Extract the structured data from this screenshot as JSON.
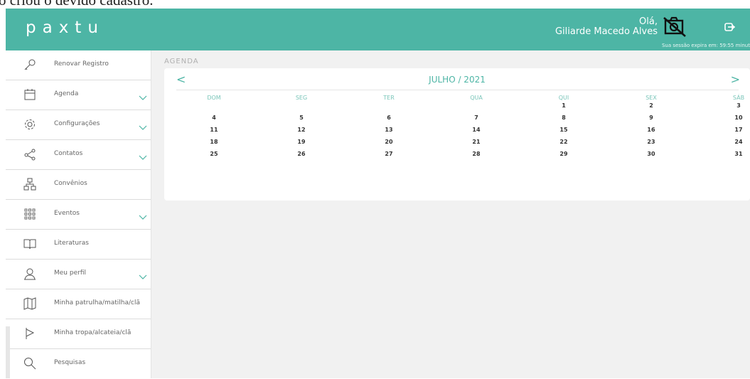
{
  "top_text": "o criou o devido cadastro.",
  "header": {
    "logo": "paxtu",
    "greeting": "Olá,",
    "user_name": "Giliarde Macedo Alves",
    "session_text": "Sua sessão expira em: 59:55 minut",
    "camera_icon": "camera-off-icon",
    "logout_icon": "logout-icon"
  },
  "sidebar": {
    "items": [
      {
        "label": "Renovar Registro",
        "icon": "key-icon",
        "has_submenu": false
      },
      {
        "label": "Agenda",
        "icon": "calendar-icon",
        "has_submenu": true
      },
      {
        "label": "Configurações",
        "icon": "gear-icon",
        "has_submenu": true
      },
      {
        "label": "Contatos",
        "icon": "share-icon",
        "has_submenu": true
      },
      {
        "label": "Convênios",
        "icon": "network-icon",
        "has_submenu": false
      },
      {
        "label": "Eventos",
        "icon": "grid-icon",
        "has_submenu": true
      },
      {
        "label": "Literaturas",
        "icon": "book-icon",
        "has_submenu": false
      },
      {
        "label": "Meu perfil",
        "icon": "user-icon",
        "has_submenu": true
      },
      {
        "label": "Minha patrulha/matilha/clã",
        "icon": "map-icon",
        "has_submenu": false
      },
      {
        "label": "Minha tropa/alcateia/clã",
        "icon": "flag-icon",
        "has_submenu": false
      },
      {
        "label": "Pesquisas",
        "icon": "search-icon",
        "has_submenu": false
      }
    ]
  },
  "main": {
    "breadcrumb": "AGENDA",
    "calendar": {
      "title": "JULHO / 2021",
      "prev": "<",
      "next": ">",
      "weekdays": [
        "DOM",
        "SEG",
        "TER",
        "QUA",
        "QUI",
        "SEX",
        "SÁB"
      ],
      "weeks": [
        [
          "",
          "",
          "",
          "",
          "1",
          "2",
          "3"
        ],
        [
          "4",
          "5",
          "6",
          "7",
          "8",
          "9",
          "10"
        ],
        [
          "11",
          "12",
          "13",
          "14",
          "15",
          "16",
          "17"
        ],
        [
          "18",
          "19",
          "20",
          "21",
          "22",
          "23",
          "24"
        ],
        [
          "25",
          "26",
          "27",
          "28",
          "29",
          "30",
          "31"
        ]
      ]
    }
  },
  "colors": {
    "brand": "#4db5a5",
    "sidebar_bg": "#ffffff",
    "main_bg": "#f1f1f1"
  }
}
